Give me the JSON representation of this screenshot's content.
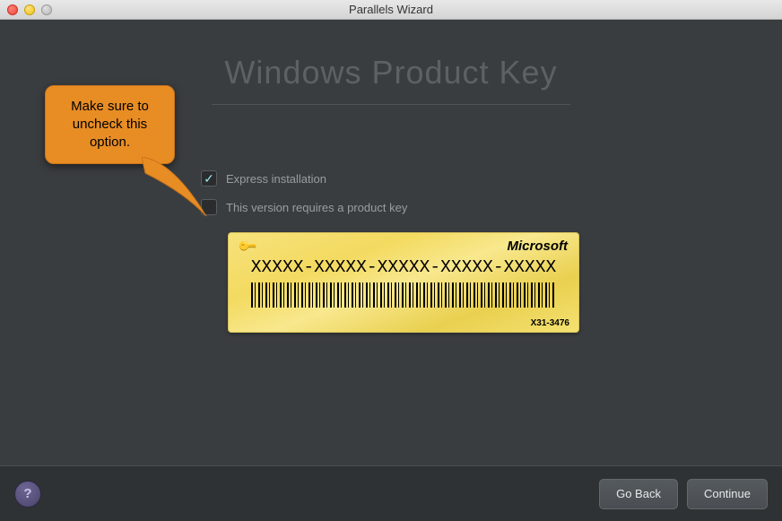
{
  "window": {
    "title": "Parallels Wizard"
  },
  "page": {
    "heading": "Windows Product Key"
  },
  "options": {
    "express_label": "Express installation",
    "express_checked": true,
    "requires_key_label": "This version requires a product key",
    "requires_key_checked": false
  },
  "card": {
    "brand": "Microsoft",
    "product_key": "XXXXX-XXXXX-XXXXX-XXXXX-XXXXX",
    "serial": "X31-3476"
  },
  "callout": {
    "text": "Make sure to uncheck this option."
  },
  "footer": {
    "back_label": "Go Back",
    "continue_label": "Continue",
    "help_label": "?"
  }
}
